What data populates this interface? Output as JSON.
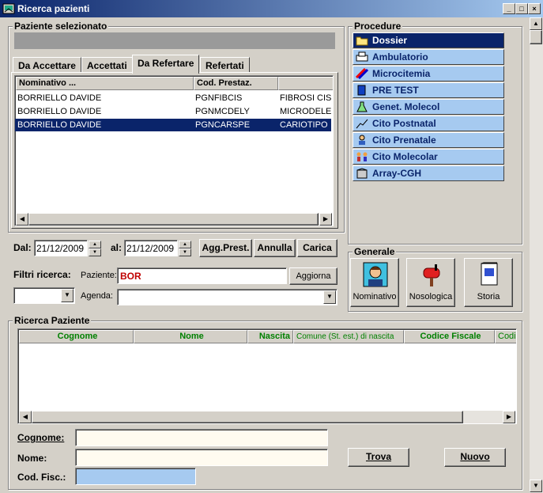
{
  "window": {
    "title": "Ricerca pazienti",
    "controls": [
      "_",
      "□",
      "×"
    ]
  },
  "patient_selected": {
    "label": "Paziente selezionato",
    "value": ""
  },
  "tabs": [
    "Da Accettare",
    "Accettati",
    "Da Refertare",
    "Refertati"
  ],
  "active_tab": "Da Refertare",
  "list": {
    "columns": [
      "Nominativo ...",
      "Cod. Prestaz.",
      ""
    ],
    "rows": [
      {
        "name": "BORRIELLO DAVIDE",
        "code": "PGNFIBCIS",
        "desc": "FIBROSI CIS"
      },
      {
        "name": "BORRIELLO DAVIDE",
        "code": "PGNMCDELY",
        "desc": "MICRODELE"
      },
      {
        "name": "BORRIELLO DAVIDE",
        "code": "PGNCARSPE",
        "desc": "CARIOTIPO"
      }
    ],
    "selected_index": 2
  },
  "dates": {
    "dal_label": "Dal:",
    "dal": "21/12/2009",
    "al_label": "al:",
    "al": "21/12/2009"
  },
  "buttons": {
    "agg_prest": "Agg.Prest.",
    "annulla": "Annulla",
    "carica": "Carica",
    "aggiorna": "Aggiorna",
    "trova": "Trova",
    "nuovo": "Nuovo"
  },
  "filters": {
    "label": "Filtri ricerca:",
    "paziente_label": "Paziente:",
    "paziente_value": "BOR",
    "agenda_label": "Agenda:",
    "agenda_value": "",
    "filter_select": ""
  },
  "procedure": {
    "label": "Procedure",
    "items": [
      {
        "label": "Dossier",
        "icon": "folder-icon"
      },
      {
        "label": "Ambulatorio",
        "icon": "printer-icon"
      },
      {
        "label": "Microcitemia",
        "icon": "pencils-icon"
      },
      {
        "label": "PRE TEST",
        "icon": "book-icon"
      },
      {
        "label": "Genet. Molecol",
        "icon": "flask-icon"
      },
      {
        "label": "Cito Postnatal",
        "icon": "chart-icon"
      },
      {
        "label": "Cito Prenatale",
        "icon": "figure-icon"
      },
      {
        "label": "Cito Molecolar",
        "icon": "people-icon"
      },
      {
        "label": "Array-CGH",
        "icon": "building-icon"
      }
    ],
    "selected_index": 0
  },
  "generale": {
    "label": "Generale",
    "buttons": [
      {
        "label": "Nominativo",
        "icon": "person-icon"
      },
      {
        "label": "Nosologica",
        "icon": "mailbox-icon"
      },
      {
        "label": "Storia",
        "icon": "document-icon"
      }
    ]
  },
  "search": {
    "label": "Ricerca Paziente",
    "columns": [
      "Cognome",
      "Nome",
      "Nascita",
      "Comune (St. est.) di nascita",
      "Codice Fiscale",
      "Codi"
    ],
    "cognome_label": "Cognome:",
    "nome_label": "Nome:",
    "codfisc_label": "Cod. Fisc.:",
    "cognome_value": "",
    "nome_value": "",
    "codfisc_value": ""
  },
  "colors": {
    "accent": "#0a246a",
    "procedure_bg": "#a6caf0",
    "header_green": "#008000",
    "filter_value": "#c00000"
  }
}
